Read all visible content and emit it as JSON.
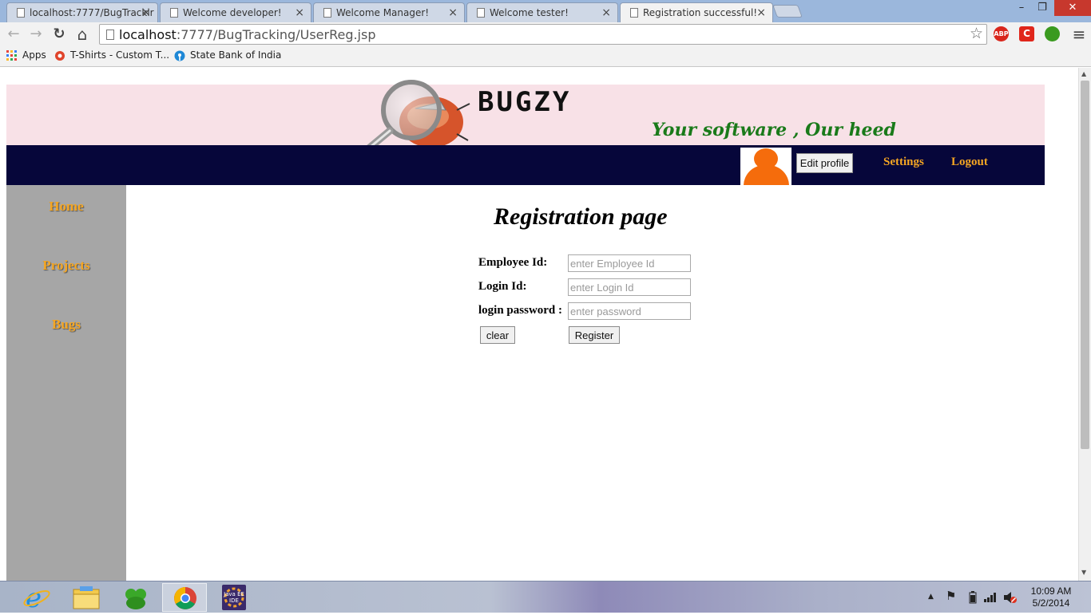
{
  "browser": {
    "tabs": [
      {
        "title": "localhost:7777/BugTrackir"
      },
      {
        "title": "Welcome developer!"
      },
      {
        "title": "Welcome Manager!"
      },
      {
        "title": "Welcome tester!"
      },
      {
        "title": "Registration successful!"
      }
    ],
    "active_tab_index": 4,
    "close_glyph": "×",
    "window_controls": {
      "minimize": "–",
      "restore": "❐",
      "close": "✕"
    },
    "nav": {
      "back": "←",
      "forward": "→",
      "reload": "↻",
      "home": "⌂"
    },
    "url": {
      "host": "localhost",
      "rest": ":7777/BugTracking/UserReg.jsp"
    },
    "star_glyph": "☆",
    "extensions": [
      {
        "name": "abp-icon",
        "label": "ABP",
        "color": "#d9261c"
      },
      {
        "name": "c-extension-icon",
        "label": "C",
        "color": "#e0261b"
      },
      {
        "name": "green-extension-icon",
        "label": "",
        "color": "#3a9a1f"
      }
    ],
    "menu_glyph": "≡",
    "bookmarks": [
      {
        "label": "Apps",
        "icon": "apps-grid-icon"
      },
      {
        "label": "T-Shirts - Custom T...",
        "icon": "tshirt-site-icon"
      },
      {
        "label": "State Bank of India",
        "icon": "sbi-icon"
      }
    ]
  },
  "site": {
    "brand": "BUGZY",
    "tagline": "Your software , Our heed",
    "colors": {
      "banner": "#f8e1e7",
      "navbar": "#06063a",
      "accent": "#f5a623",
      "sidebar": "#a6a6a6",
      "tagline": "#1a7a1a",
      "avatar": "#f56c0c"
    },
    "nav": {
      "edit_profile": "Edit profile",
      "settings": "Settings",
      "logout": "Logout"
    },
    "sidebar": [
      {
        "label": "Home"
      },
      {
        "label": "Projects"
      },
      {
        "label": "Bugs"
      }
    ]
  },
  "form": {
    "title": "Registration page",
    "fields": [
      {
        "label": "Employee Id:",
        "placeholder": "enter Employee Id",
        "value": ""
      },
      {
        "label": "Login Id:",
        "placeholder": "enter Login Id",
        "value": ""
      },
      {
        "label": "login password :",
        "placeholder": "enter password",
        "value": ""
      }
    ],
    "buttons": {
      "clear": "clear",
      "register": "Register"
    }
  },
  "taskbar": {
    "apps": [
      {
        "name": "internet-explorer-icon"
      },
      {
        "name": "file-explorer-icon"
      },
      {
        "name": "green-app-icon"
      },
      {
        "name": "chrome-icon",
        "active": true
      },
      {
        "name": "java-ee-ide-icon",
        "label": "Java EE IDE"
      }
    ],
    "tray": {
      "show_hidden": "▲",
      "flag": "⚑"
    },
    "clock": {
      "time": "10:09 AM",
      "date": "5/2/2014"
    }
  }
}
